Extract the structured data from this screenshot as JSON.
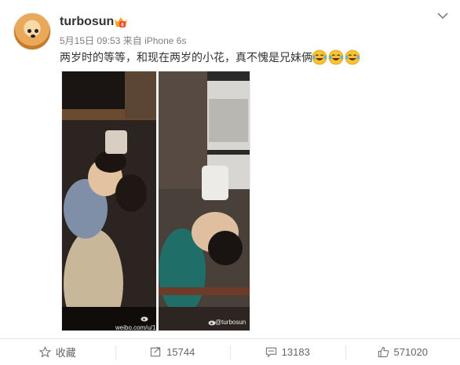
{
  "post": {
    "username": "turbosun",
    "date": "5月15日 09:53",
    "source": "来自 iPhone 6s",
    "text": "两岁时的等等，和现在两岁的小花，真不愧是兄妹俩",
    "emojis": [
      "laugh-cry-emoji",
      "laugh-cry-emoji",
      "laugh-cry-emoji"
    ],
    "image": {
      "watermark_left": "weibo.com/u/1",
      "watermark_right": "@turbosun"
    }
  },
  "actions": {
    "favorite_label": "收藏",
    "repost_count": "15744",
    "comment_count": "13183",
    "like_count": "571020"
  },
  "colors": {
    "text": "#333333",
    "meta": "#808080",
    "vip": "#f5a623",
    "emoji": "#f7c530"
  }
}
